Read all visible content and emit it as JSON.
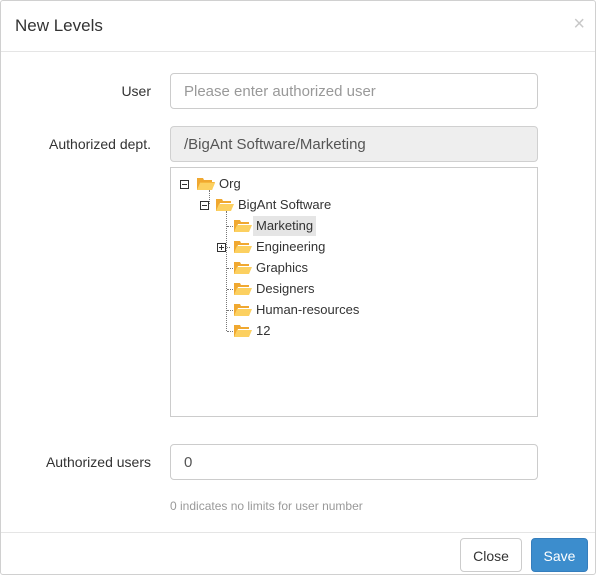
{
  "dialog": {
    "title": "New Levels",
    "close_symbol": "×"
  },
  "form": {
    "user_label": "User",
    "user_placeholder": "Please enter authorized user",
    "user_value": "",
    "dept_label": "Authorized dept.",
    "dept_value": "/BigAnt Software/Marketing",
    "users_label": "Authorized users",
    "users_value": "0",
    "users_hint": "0 indicates no limits for user number"
  },
  "tree": {
    "root": "Org",
    "company": "BigAnt Software",
    "children": [
      "Marketing",
      "Engineering",
      "Graphics",
      "Designers",
      "Human-resources",
      "12"
    ],
    "selected": "Marketing",
    "folder_color": "#f9c23c"
  },
  "footer": {
    "close_label": "Close",
    "save_label": "Save"
  },
  "colors": {
    "primary": "#3c8dcd",
    "selection": "#e5e5e5"
  }
}
